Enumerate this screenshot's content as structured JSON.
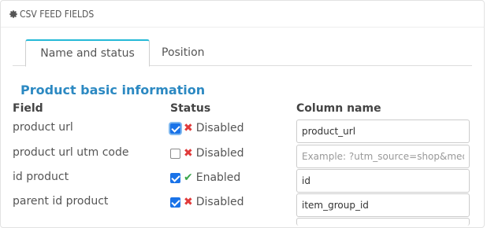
{
  "panel": {
    "title": "CSV FEED FIELDS",
    "icon": "gear-icon"
  },
  "tabs": [
    {
      "label": "Name and status",
      "active": true
    },
    {
      "label": "Position",
      "active": false
    }
  ],
  "section": {
    "title": "Product basic information"
  },
  "columns": {
    "field": "Field",
    "status": "Status",
    "column_name": "Column name"
  },
  "rows": [
    {
      "field": "product url",
      "checked": true,
      "focused": true,
      "status_icon": "x-icon",
      "status": "Disabled",
      "value": "product_url",
      "placeholder": ""
    },
    {
      "field": "product url utm code",
      "checked": false,
      "focused": false,
      "status_icon": "x-icon",
      "status": "Disabled",
      "value": "",
      "placeholder": "Example: ?utm_source=shop&med=w"
    },
    {
      "field": "id product",
      "checked": true,
      "focused": false,
      "status_icon": "check-icon",
      "status": "Enabled",
      "value": "id",
      "placeholder": ""
    },
    {
      "field": "parent id product",
      "checked": true,
      "focused": false,
      "status_icon": "x-icon",
      "status": "Disabled",
      "value": "item_group_id",
      "placeholder": ""
    }
  ],
  "colors": {
    "accent": "#25b9d7",
    "section_title": "#2c89c2",
    "disabled": "#e03a3a",
    "enabled": "#3aa64a"
  }
}
